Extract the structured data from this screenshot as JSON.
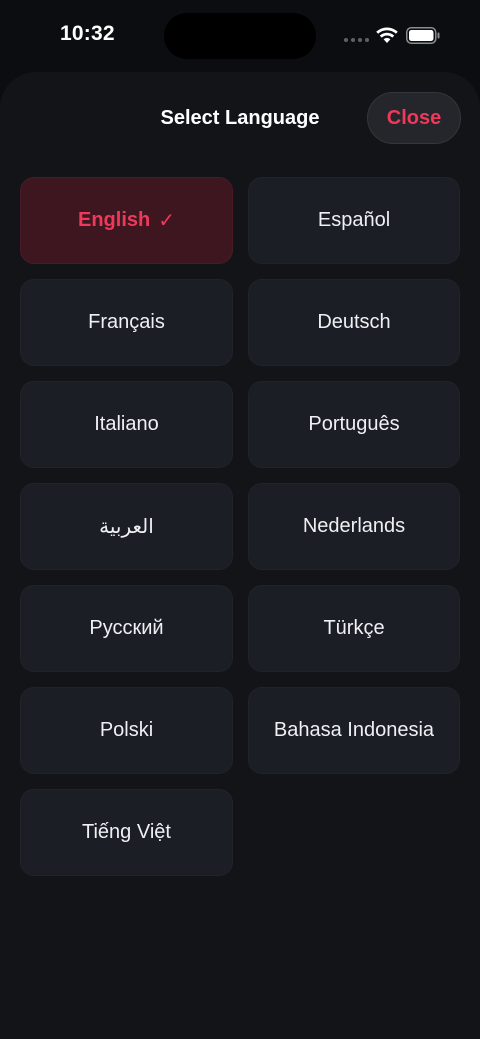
{
  "status_bar": {
    "time": "10:32"
  },
  "sheet": {
    "title": "Select Language",
    "close_label": "Close"
  },
  "languages": [
    {
      "label": "English",
      "selected": true,
      "check": "✓"
    },
    {
      "label": "Español"
    },
    {
      "label": "Français"
    },
    {
      "label": "Deutsch"
    },
    {
      "label": "Italiano"
    },
    {
      "label": "Português"
    },
    {
      "label": "العربية"
    },
    {
      "label": "Nederlands"
    },
    {
      "label": "Русский"
    },
    {
      "label": "Türkçe"
    },
    {
      "label": "Polski"
    },
    {
      "label": "Bahasa Indonesia"
    },
    {
      "label": "Tiếng Việt"
    }
  ],
  "colors": {
    "accent": "#f0385a",
    "selected_bg": "#3d1620",
    "button_bg": "#1b1e25",
    "sheet_bg": "#121418"
  }
}
